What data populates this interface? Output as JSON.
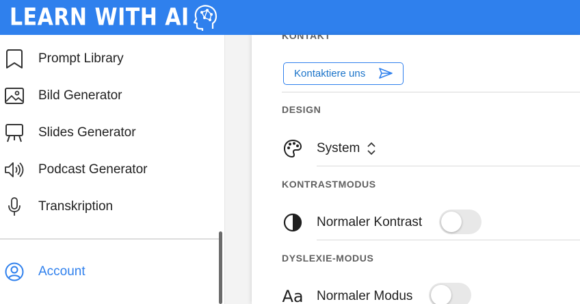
{
  "header": {
    "brand": "LEARN WITH AI",
    "brand_icon": "ai-head-circuit-icon",
    "background": "#2f80ed"
  },
  "sidebar": {
    "items": [
      {
        "label": "Prompt Library",
        "icon": "bookmark-icon"
      },
      {
        "label": "Bild Generator",
        "icon": "image-icon"
      },
      {
        "label": "Slides Generator",
        "icon": "presentation-easel-icon"
      },
      {
        "label": "Podcast Generator",
        "icon": "speaker-icon"
      },
      {
        "label": "Transkription",
        "icon": "microphone-icon"
      },
      {
        "label": "Account",
        "icon": "account-circle-icon",
        "active": true
      }
    ]
  },
  "settings": {
    "kontakt": {
      "title": "KONTAKT",
      "button_label": "Kontaktiere uns",
      "button_icon": "send-icon"
    },
    "design": {
      "title": "DESIGN",
      "value": "System",
      "icon": "palette-icon"
    },
    "kontrast": {
      "title": "KONTRASTMODUS",
      "value": "Normaler Kontrast",
      "icon": "contrast-icon",
      "enabled": false
    },
    "dyslexie": {
      "title": "DYSLEXIE-MODUS",
      "value": "Normaler Modus",
      "icon": "font-aa-icon",
      "enabled": false
    }
  },
  "colors": {
    "accent": "#2f80ed",
    "section_title": "#5f5f5f",
    "toggle_off": "#e8e8e8"
  }
}
